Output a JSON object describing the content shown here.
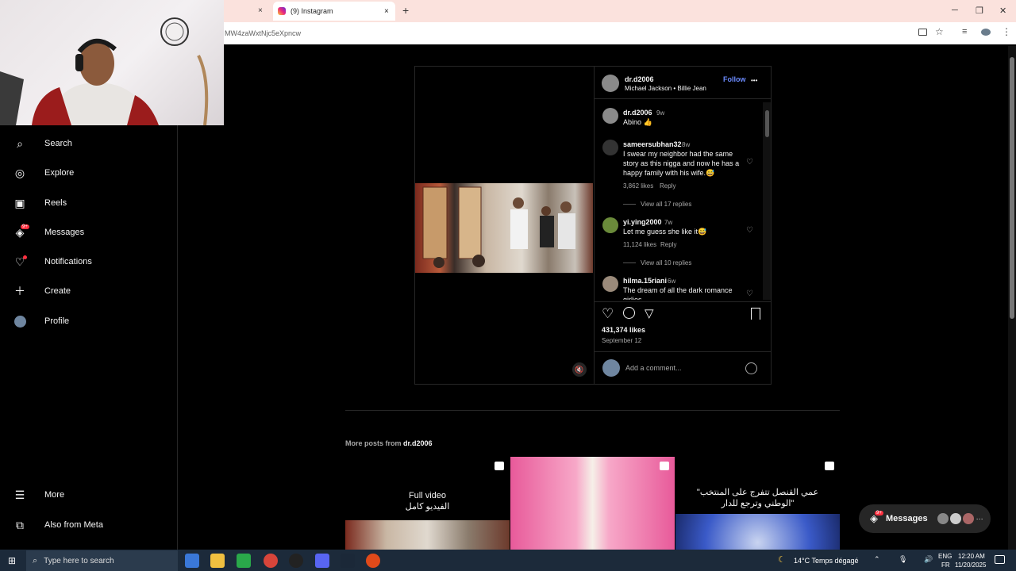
{
  "browser": {
    "tab_title": "(9) Instagram",
    "url": "MW4zaWxtNjc5eXpncw",
    "new_tab": "+",
    "tab_close": "×",
    "win_minimize": "─",
    "win_restore": "❐",
    "win_close": "✕"
  },
  "sidebar": {
    "items": [
      {
        "label": "Search",
        "icon": "search-icon"
      },
      {
        "label": "Explore",
        "icon": "compass-icon"
      },
      {
        "label": "Reels",
        "icon": "reels-icon"
      },
      {
        "label": "Messages",
        "icon": "messenger-icon",
        "badge": "9+"
      },
      {
        "label": "Notifications",
        "icon": "heart-icon"
      },
      {
        "label": "Create",
        "icon": "plus-icon"
      },
      {
        "label": "Profile",
        "icon": "avatar-icon"
      }
    ],
    "more_label": "More",
    "meta_label": "Also from Meta"
  },
  "post": {
    "author": "dr.d2006",
    "music": "Michael Jackson • Billie Jean",
    "follow": "Follow",
    "menu": "•••",
    "caption_user": "dr.d2006",
    "caption_time": "9w",
    "caption_text": "Abino 👍",
    "comments": [
      {
        "user": "sameersubhan32",
        "time": "8w",
        "text": "I swear my neighbor had the same story as this nigga and now he has a happy family with his wife.😅",
        "likes": "3,862 likes",
        "reply": "Reply",
        "view": "View all 17 replies"
      },
      {
        "user": "yi.ying2000",
        "time": "7w",
        "text": "Let me guess she like it😅",
        "likes": "11,124 likes",
        "reply": "Reply",
        "view": "View all 10 replies"
      },
      {
        "user": "hilma.15riani",
        "time": "6w",
        "text": "The dream of all the dark romance girlies"
      }
    ],
    "likes": "431,374 likes",
    "date": "September 12",
    "add_comment": "Add a comment..."
  },
  "more_posts": {
    "label": "More posts from",
    "user": "dr.d2006",
    "thumb1_en": "Full video",
    "thumb1_ar": "الفيديو كامل",
    "thumb3_ar1": "\"عمي القنصل تتفرج على المنتخب",
    "thumb3_ar2": "الوطني وترجع للدار\""
  },
  "messages_pill": {
    "label": "Messages",
    "badge": "9+"
  },
  "taskbar": {
    "search_placeholder": "Type here to search",
    "weather": "14°C  Temps dégagé",
    "lang1": "ENG",
    "lang2": "FR",
    "time": "12:20 AM",
    "date": "11/20/2025"
  },
  "colors": {
    "accent": "#0095f6",
    "follow": "#6b8afd",
    "badge": "#ff3040"
  }
}
